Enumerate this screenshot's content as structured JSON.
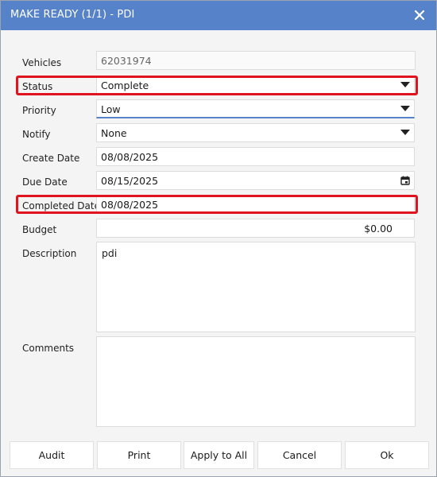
{
  "dialog": {
    "title": "MAKE READY (1/1) - PDI",
    "close_icon": "close-icon"
  },
  "fields": {
    "vehicles": {
      "label": "Vehicles",
      "value": "62031974"
    },
    "status": {
      "label": "Status",
      "value": "Complete"
    },
    "priority": {
      "label": "Priority",
      "value": "Low"
    },
    "notify": {
      "label": "Notify",
      "value": "None"
    },
    "create_date": {
      "label": "Create Date",
      "value": "08/08/2025"
    },
    "due_date": {
      "label": "Due Date",
      "value": "08/15/2025",
      "icon": "calendar-icon"
    },
    "completed_date": {
      "label": "Completed Date",
      "value": "08/08/2025"
    },
    "budget": {
      "label": "Budget",
      "value": "$0.00"
    },
    "description": {
      "label": "Description",
      "value": "pdi"
    },
    "comments": {
      "label": "Comments",
      "value": ""
    }
  },
  "buttons": {
    "audit": "Audit",
    "print": "Print",
    "apply_to_all": "Apply to All",
    "cancel": "Cancel",
    "ok": "Ok"
  },
  "colors": {
    "titlebar": "#5582c8",
    "highlight": "#e0141e"
  }
}
